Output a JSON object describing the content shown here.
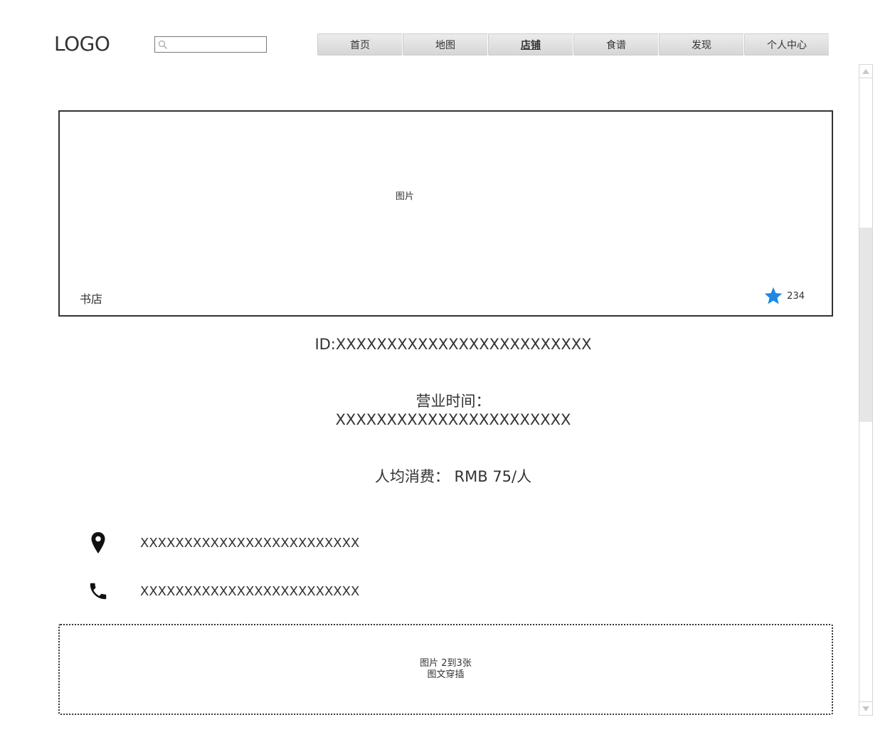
{
  "header": {
    "logo": "LOGO",
    "search": {
      "value": "",
      "placeholder": ""
    },
    "nav": [
      {
        "label": "首页",
        "active": false
      },
      {
        "label": "地图",
        "active": false
      },
      {
        "label": "店铺",
        "active": true
      },
      {
        "label": "食谱",
        "active": false
      },
      {
        "label": "发现",
        "active": false
      },
      {
        "label": "个人中心",
        "active": false
      }
    ]
  },
  "banner": {
    "placeholder": "图片",
    "shop_name": "书店",
    "favorite_count": "234",
    "star_color": "#1E88E5"
  },
  "info": {
    "id": "ID:XXXXXXXXXXXXXXXXXXXXXXXXX",
    "hours_label": "营业时间：",
    "hours_value": "XXXXXXXXXXXXXXXXXXXXXXX",
    "price": "人均消费： RMB  75/人",
    "address": "XXXXXXXXXXXXXXXXXXXXXXXXX",
    "phone": "XXXXXXXXXXXXXXXXXXXXXXXXX"
  },
  "gallery": {
    "line1": "图片  2到3张",
    "line2": "图文穿插"
  }
}
